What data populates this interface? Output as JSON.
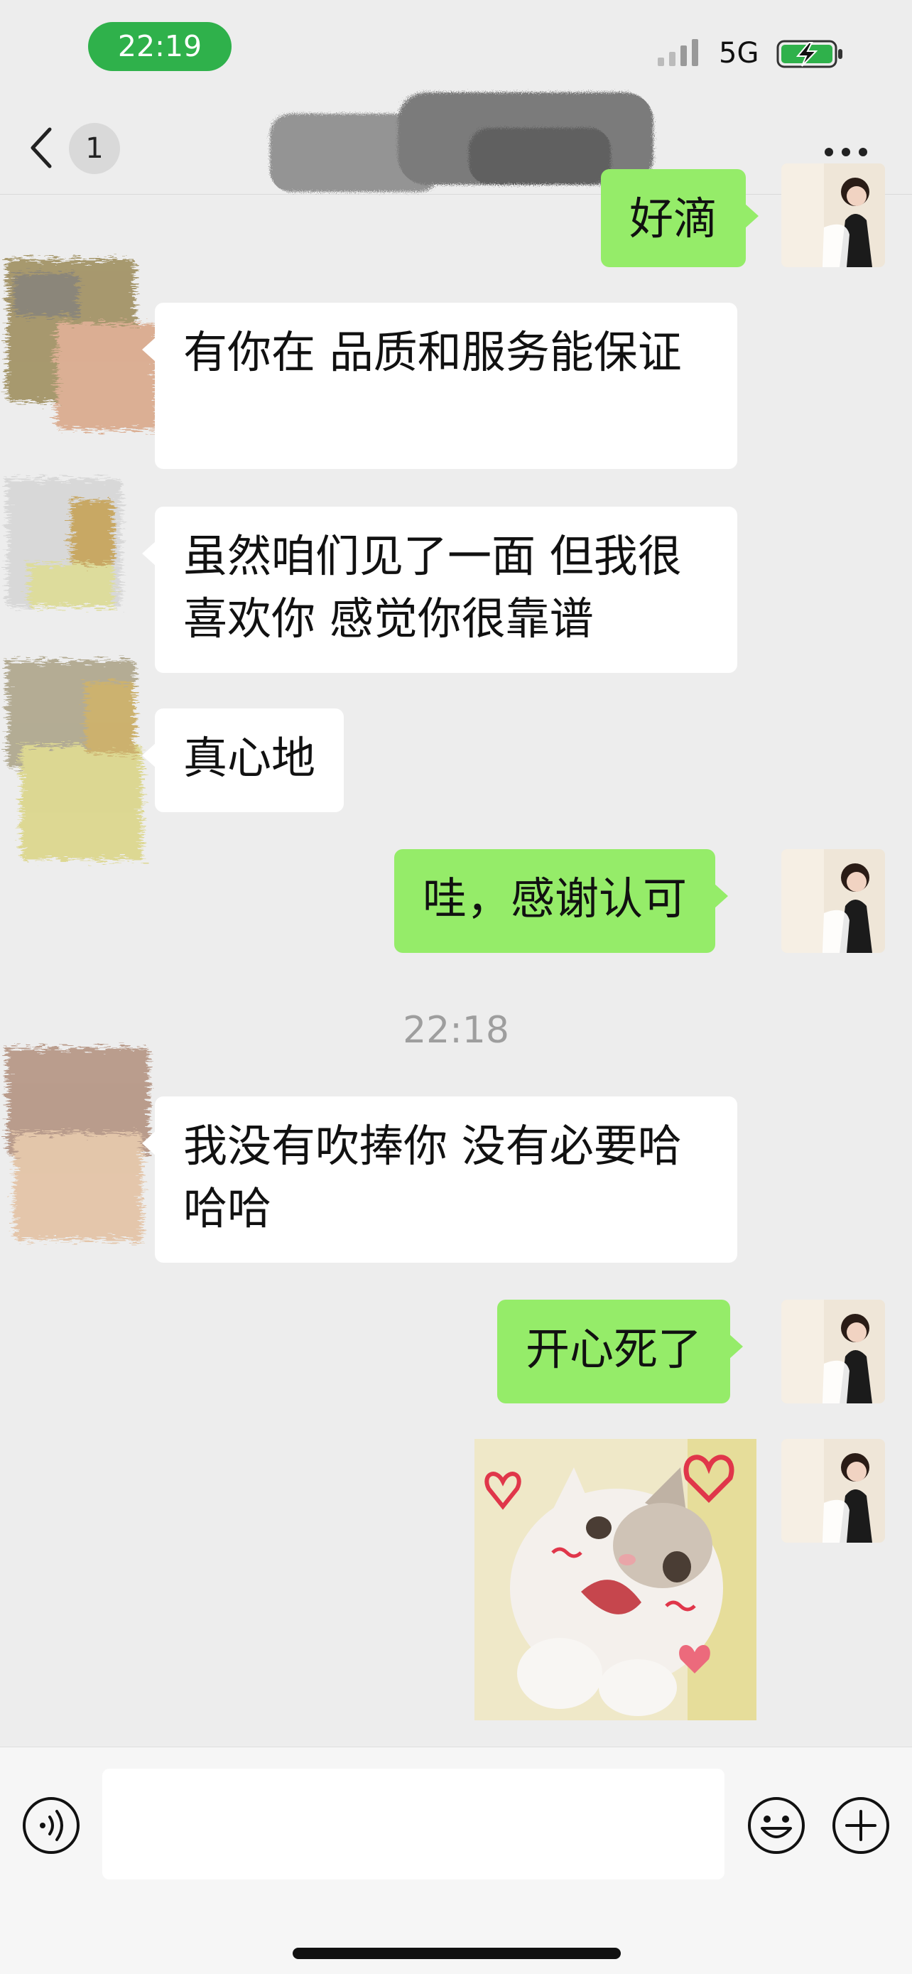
{
  "status_bar": {
    "time": "22:19",
    "network": "5G",
    "battery_charging": true,
    "accent": "#2fb14b"
  },
  "nav": {
    "back_label": "",
    "unread_count": "1",
    "title": "",
    "more_icon": "more-icon"
  },
  "messages": [
    {
      "side": "sent",
      "type": "text",
      "text": "好滴"
    },
    {
      "side": "received",
      "type": "text",
      "text": "有你在 品质和服务能保证"
    },
    {
      "side": "received",
      "type": "text",
      "text": "虽然咱们见了一面 但我很喜欢你 感觉你很靠谱"
    },
    {
      "side": "received",
      "type": "text",
      "text": "真心地"
    },
    {
      "side": "sent",
      "type": "text",
      "text": "哇，感谢认可"
    },
    {
      "side": "received",
      "type": "text",
      "text": "我没有吹捧你 没有必要哈哈哈"
    },
    {
      "side": "sent",
      "type": "text",
      "text": "开心死了"
    },
    {
      "side": "sent",
      "type": "sticker",
      "sticker": "cat-hearts-sticker"
    }
  ],
  "timestamp": "22:18",
  "input": {
    "value": "",
    "placeholder": ""
  },
  "colors": {
    "sent_bubble": "#95ec69",
    "received_bubble": "#ffffff",
    "background": "#ededed"
  }
}
